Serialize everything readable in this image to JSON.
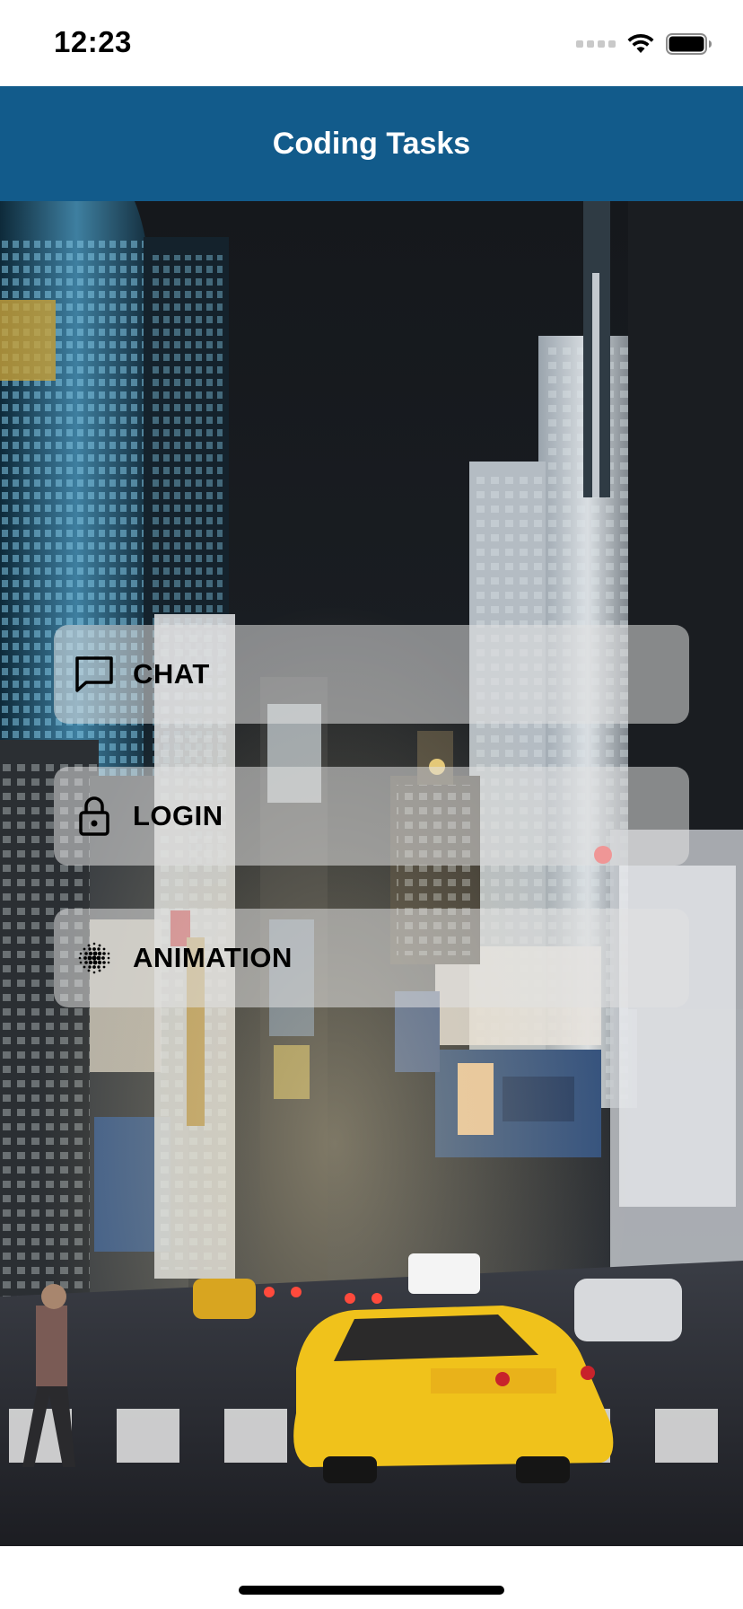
{
  "status_bar": {
    "time": "12:23",
    "icons": [
      "cellular-signal-icon",
      "wifi-icon",
      "battery-icon"
    ]
  },
  "nav": {
    "title": "Coding Tasks",
    "background_color": "#125b8b"
  },
  "background": {
    "description_icon": "city-night-street-photo"
  },
  "menu": {
    "items": [
      {
        "label": "CHAT",
        "icon": "chat-bubble-icon"
      },
      {
        "label": "LOGIN",
        "icon": "lock-icon"
      },
      {
        "label": "ANIMATION",
        "icon": "dotted-sphere-icon"
      }
    ]
  }
}
